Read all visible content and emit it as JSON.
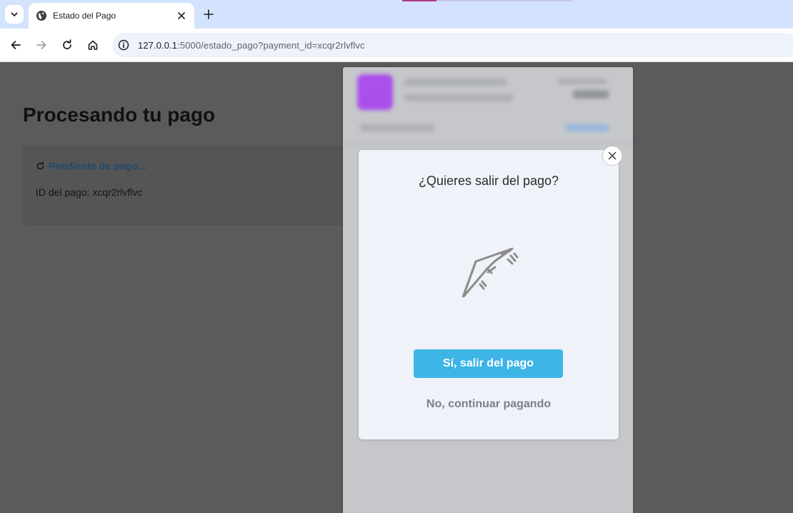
{
  "browser": {
    "tab_title": "Estado del Pago",
    "url_host": "127.0.0.1",
    "url_rest": ":5000/estado_pago?payment_id=xcqr2rlvflvc",
    "icons": {
      "tab_search": "chevron-down-icon",
      "favicon": "globe-icon",
      "close": "close-icon",
      "new_tab": "plus-icon",
      "back": "arrow-left-icon",
      "forward": "arrow-right-icon",
      "reload": "reload-icon",
      "home": "home-icon",
      "site_info": "info-icon"
    }
  },
  "page": {
    "title": "Procesando tu pago",
    "status_text": "Pendiente de pago...",
    "payment_id_text": "ID del pago: xcqr2rlvflvc",
    "colors": {
      "overlay": "#5b5b5b",
      "status": "#1f4a6e"
    }
  },
  "checkout": {
    "merchant_logo_color": "#a63bf0"
  },
  "modal": {
    "title": "¿Quieres salir del pago?",
    "confirm_label": "Sí, salir del pago",
    "cancel_label": "No, continuar pagando",
    "colors": {
      "confirm_bg": "#3db5e6",
      "cancel_text": "#7b7f87"
    },
    "icon": "hang-glider-icon"
  }
}
